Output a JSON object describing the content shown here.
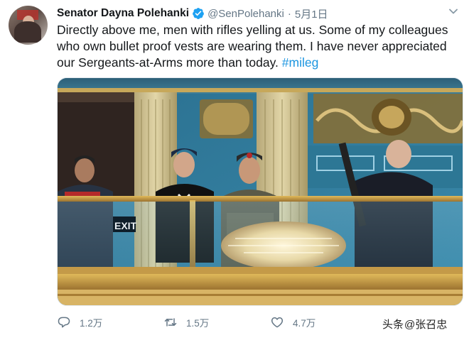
{
  "author": {
    "name": "Senator Dayna Polehanki",
    "handle": "@SenPolehanki",
    "separator": "·",
    "date": "5月1日"
  },
  "tweet": {
    "text": "Directly above me, men with rifles yelling at us. Some of my colleagues who own bullet proof vests are wearing them. I have never appreciated our Sergeants-at-Arms more than today.",
    "hashtag": "#mileg"
  },
  "photo": {
    "sign_text": "EXIT"
  },
  "actions": {
    "reply_count": "1.2万",
    "retweet_count": "1.5万",
    "like_count": "4.7万"
  },
  "watermark": {
    "source": "头条",
    "author": "@张召忠"
  },
  "colors": {
    "link": "#1b95e0",
    "secondary_text": "#657786",
    "verified": "#1da1f2"
  },
  "icons": [
    "verified-badge-icon",
    "caret-down-icon",
    "reply-icon",
    "retweet-icon",
    "like-icon"
  ]
}
